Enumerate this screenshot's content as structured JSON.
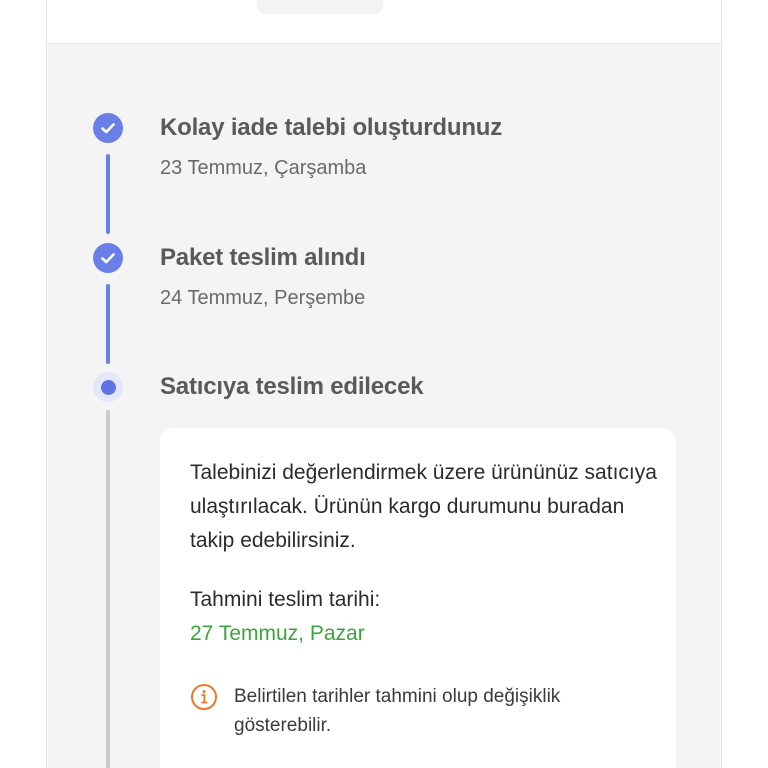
{
  "colors": {
    "accent": "#6b7fe8",
    "pending_line": "#c9c9c9",
    "estimate_date": "#3da33d",
    "warning_icon": "#e87a2a"
  },
  "timeline": {
    "steps": [
      {
        "status": "completed",
        "title": "Kolay iade talebi oluşturdunuz",
        "date": "23 Temmuz, Çarşamba",
        "icon": "check-icon"
      },
      {
        "status": "completed",
        "title": "Paket teslim alındı",
        "date": "24 Temmuz, Perşembe",
        "icon": "check-icon"
      },
      {
        "status": "current",
        "title": "Satıcıya teslim edilecek",
        "icon": "current-step-dot-icon"
      }
    ]
  },
  "info_card": {
    "description": "Talebinizi değerlendirmek üzere ürününüz satıcıya ulaştırılacak. Ürünün kargo durumunu buradan takip edebilirsiniz.",
    "estimate_label": "Tahmini teslim tarihi:",
    "estimate_date": "27 Temmuz, Pazar",
    "note_icon": "info-icon",
    "note": "Belirtilen tarihler tahmini olup değişiklik gösterebilir."
  }
}
